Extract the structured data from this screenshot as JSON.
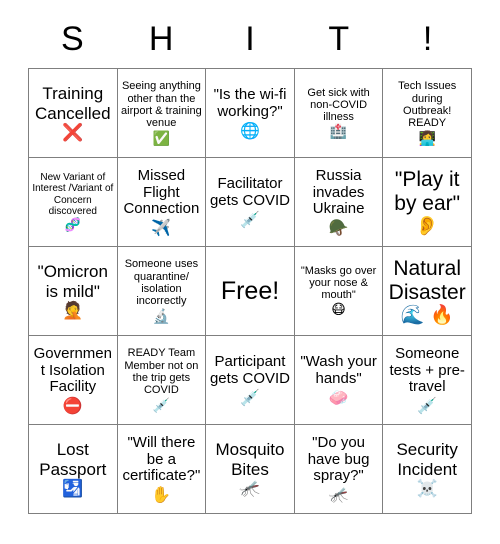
{
  "header": {
    "letters": [
      "S",
      "H",
      "I",
      "T",
      "!"
    ]
  },
  "card": {
    "rows": [
      [
        {
          "text": "Training\nCancelled",
          "emoji": "❌",
          "icon": "cross-mark-icon",
          "size": "lg"
        },
        {
          "text": "Seeing anything other than the airport & training venue",
          "emoji": "✅",
          "icon": "check-mark-button-icon",
          "size": "sm"
        },
        {
          "text": "\"Is the wi-fi working?\"",
          "emoji": "🌐",
          "icon": "globe-with-meridians-icon",
          "size": "md"
        },
        {
          "text": "Get sick with non-COVID illness",
          "emoji": "🏥",
          "icon": "hospital-icon",
          "size": "sm"
        },
        {
          "text": "Tech Issues during Outbreak! READY",
          "emoji": "👩‍💻",
          "icon": "technologist-icon",
          "size": "sm"
        }
      ],
      [
        {
          "text": "New Variant of Interest /Variant of Concern discovered",
          "emoji": "🧬",
          "icon": "dna-icon",
          "size": "xs"
        },
        {
          "text": "Missed Flight Connection",
          "emoji": "✈️",
          "icon": "airplane-icon",
          "size": "md"
        },
        {
          "text": "Facilitator gets COVID",
          "emoji": "💉",
          "icon": "syringe-icon",
          "size": "md"
        },
        {
          "text": "Russia invades Ukraine",
          "emoji": "🪖",
          "icon": "military-helmet-icon",
          "size": "md"
        },
        {
          "text": "\"Play it by ear\"",
          "emoji": "👂",
          "icon": "ear-icon",
          "size": "xl"
        }
      ],
      [
        {
          "text": "\"Omicron is mild\"",
          "emoji": "🤦",
          "icon": "face-palm-icon",
          "size": "lg"
        },
        {
          "text": "Someone uses quarantine/ isolation incorrectly",
          "emoji": "🔬",
          "icon": "microscope-icon",
          "size": "sm"
        },
        {
          "text": "Free!",
          "emoji": "",
          "icon": "free-space",
          "size": "free"
        },
        {
          "text": "\"Masks go over your nose & mouth\"",
          "emoji": "😷",
          "icon": "face-with-medical-mask-icon",
          "size": "sm"
        },
        {
          "text": "Natural Disaster",
          "emoji": "🌊 🔥",
          "icon": "water-wave-and-fire-icon",
          "size": "xl"
        }
      ],
      [
        {
          "text": "Government Isolation Facility",
          "emoji": "⛔",
          "icon": "no-entry-icon",
          "size": "md"
        },
        {
          "text": "READY Team Member not on the trip gets COVID",
          "emoji": "💉",
          "icon": "syringe-icon",
          "size": "sm"
        },
        {
          "text": "Participant gets COVID",
          "emoji": "💉",
          "icon": "syringe-icon",
          "size": "md"
        },
        {
          "text": "\"Wash your hands\"",
          "emoji": "🧼",
          "icon": "soap-icon",
          "size": "md"
        },
        {
          "text": "Someone tests + pre-travel",
          "emoji": "💉",
          "icon": "syringe-icon",
          "size": "md"
        }
      ],
      [
        {
          "text": "Lost Passport",
          "emoji": "🛂",
          "icon": "passport-control-icon",
          "size": "lg"
        },
        {
          "text": "\"Will there be a certificate?\"",
          "emoji": "✋",
          "icon": "raised-hand-icon",
          "size": "md"
        },
        {
          "text": "Mosquito Bites",
          "emoji": "🦟",
          "icon": "mosquito-icon",
          "size": "lg"
        },
        {
          "text": "\"Do you have bug spray?\"",
          "emoji": "🦟",
          "icon": "mosquito-icon",
          "size": "md"
        },
        {
          "text": "Security Incident",
          "emoji": "☠️",
          "icon": "skull-and-crossbones-icon",
          "size": "lg"
        }
      ]
    ]
  },
  "colors": {
    "border": "#7f7f7f",
    "text": "#000000",
    "background": "#ffffff"
  }
}
